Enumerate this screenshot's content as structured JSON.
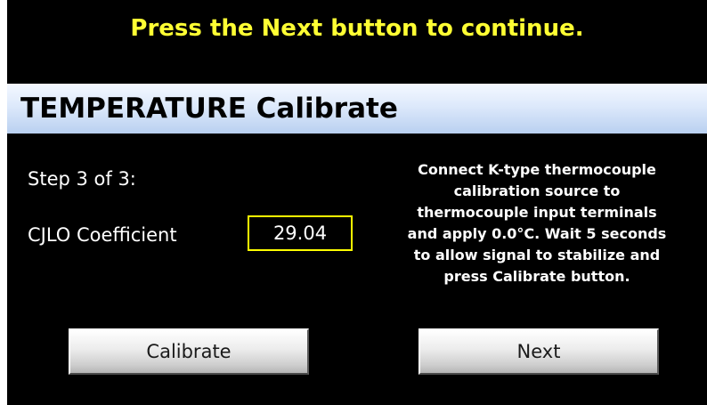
{
  "header": {
    "instruction": "Press the Next button to continue.",
    "title": "TEMPERATURE Calibrate"
  },
  "step": {
    "label": "Step 3 of 3:"
  },
  "coefficient": {
    "label": "CJLO Coefficient",
    "value": "29.04"
  },
  "description": {
    "lines": [
      "Connect K-type thermocouple",
      "calibration source to",
      "thermocouple input terminals",
      "and apply 0.0°C. Wait 5 seconds",
      "to allow signal to stabilize and",
      "press Calibrate button."
    ]
  },
  "buttons": {
    "calibrate_label": "Calibrate",
    "next_label": "Next"
  },
  "colors": {
    "background": "#000000",
    "instruction_text": "#ffff33",
    "value_box_border": "#ffff00",
    "title_bar": "#dde9fb"
  }
}
